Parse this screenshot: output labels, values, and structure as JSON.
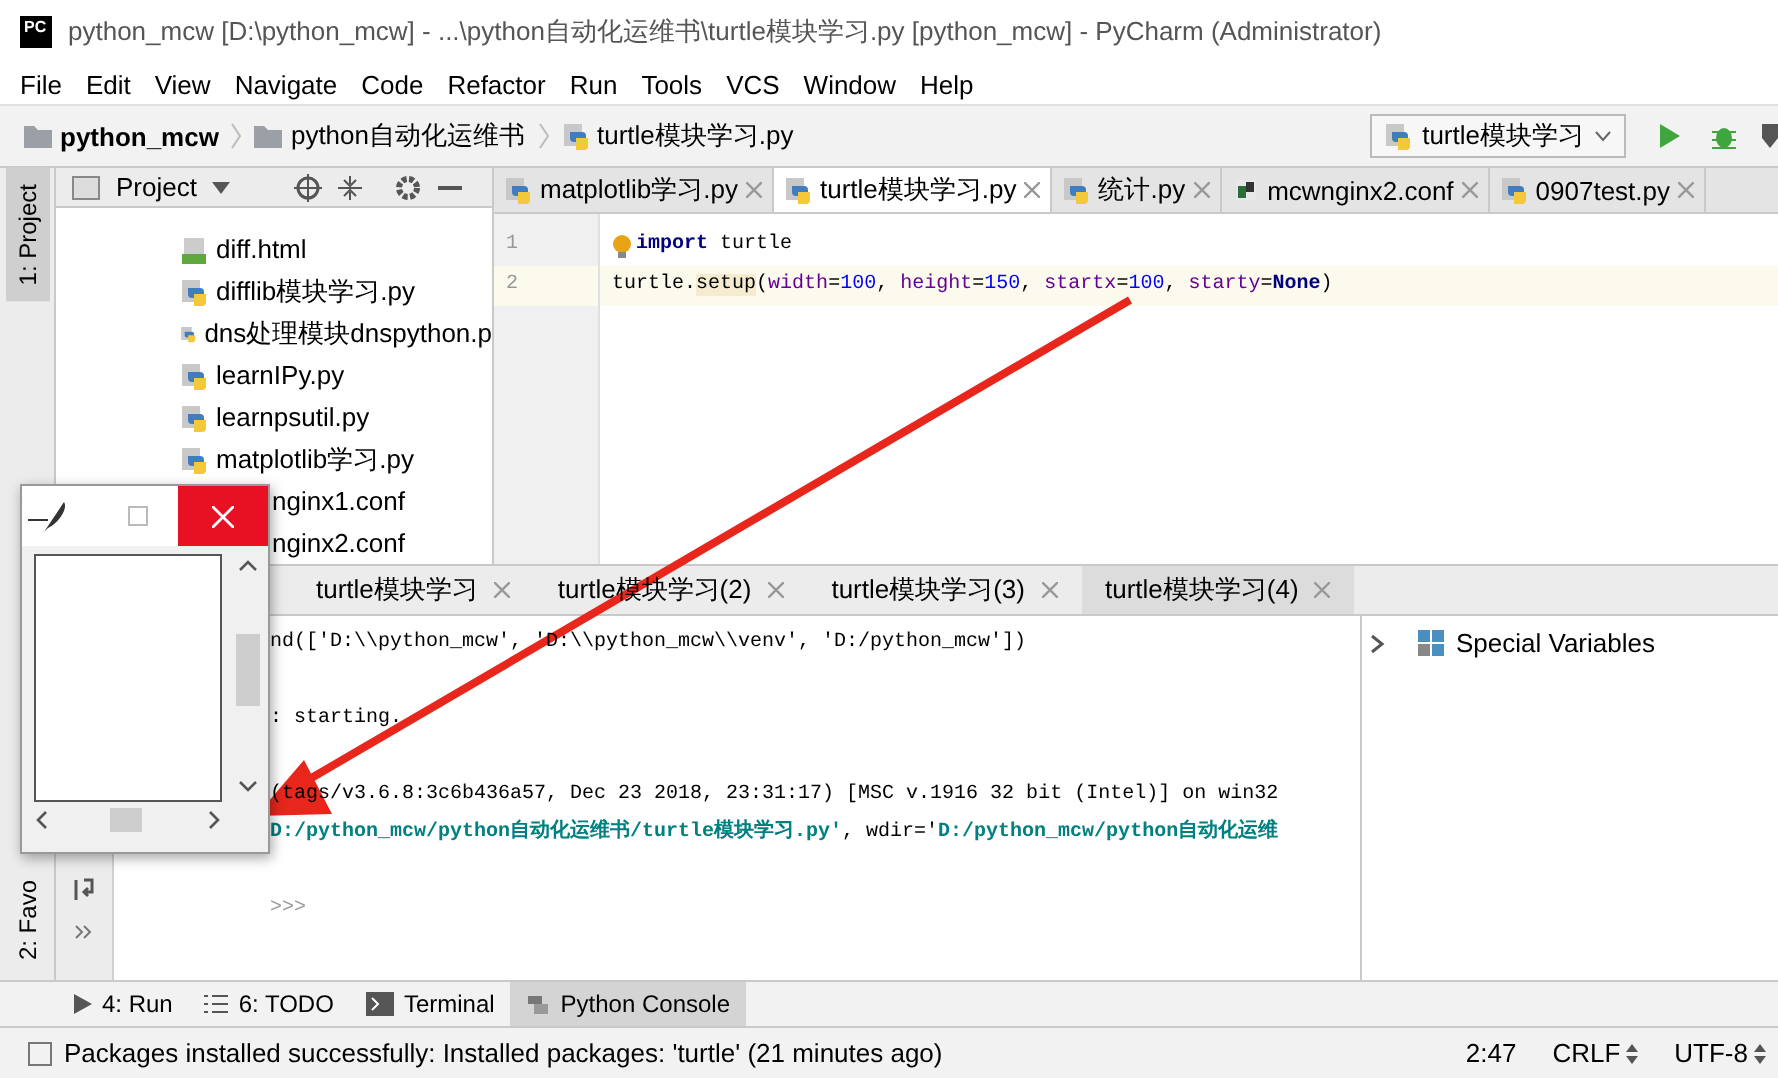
{
  "window": {
    "title": "python_mcw [D:\\python_mcw] - ...\\python自动化运维书\\turtle模块学习.py [python_mcw] - PyCharm (Administrator)",
    "logo": "PC"
  },
  "menu": [
    "File",
    "Edit",
    "View",
    "Navigate",
    "Code",
    "Refactor",
    "Run",
    "Tools",
    "VCS",
    "Window",
    "Help"
  ],
  "breadcrumbs": [
    {
      "label": "python_mcw",
      "kind": "project"
    },
    {
      "label": "python自动化运维书",
      "kind": "folder"
    },
    {
      "label": "turtle模块学习.py",
      "kind": "file"
    }
  ],
  "run_config": {
    "label": "turtle模块学习"
  },
  "left_strip": {
    "top": "1: Project",
    "bottom": "2: Favo"
  },
  "project_panel": {
    "title": "Project",
    "items": [
      {
        "label": "diff.html",
        "kind": "html"
      },
      {
        "label": "difflib模块学习.py",
        "kind": "py"
      },
      {
        "label": "dns处理模块dnspython.p",
        "kind": "py"
      },
      {
        "label": "learnIPy.py",
        "kind": "py"
      },
      {
        "label": "learnpsutil.py",
        "kind": "py"
      },
      {
        "label": "matplotlib学习.py",
        "kind": "py"
      },
      {
        "label": "nginx1.conf"
      },
      {
        "label": "nginx2.conf"
      }
    ]
  },
  "editor_tabs": [
    {
      "label": "matplotlib学习.py",
      "kind": "py",
      "selected": false
    },
    {
      "label": "turtle模块学习.py",
      "kind": "py",
      "selected": true
    },
    {
      "label": "统计.py",
      "kind": "py",
      "selected": false
    },
    {
      "label": "mcwnginx2.conf",
      "kind": "conf",
      "selected": false
    },
    {
      "label": "0907test.py",
      "kind": "py",
      "selected": false
    }
  ],
  "editor": {
    "lines": [
      {
        "number": "1",
        "current": false,
        "tokens": [
          {
            "text": "import",
            "kind": "keyword"
          },
          {
            "text": " turtle",
            "kind": "plain"
          }
        ]
      },
      {
        "number": "2",
        "current": true,
        "tokens": [
          {
            "text": "turtle.",
            "kind": "plain"
          },
          {
            "text": "setup",
            "kind": "call"
          },
          {
            "text": "(",
            "kind": "plain"
          },
          {
            "text": "width",
            "kind": "param"
          },
          {
            "text": "=",
            "kind": "plain"
          },
          {
            "text": "100",
            "kind": "number"
          },
          {
            "text": ", ",
            "kind": "plain"
          },
          {
            "text": "height",
            "kind": "param"
          },
          {
            "text": "=",
            "kind": "plain"
          },
          {
            "text": "150",
            "kind": "number"
          },
          {
            "text": ", ",
            "kind": "plain"
          },
          {
            "text": "startx",
            "kind": "param"
          },
          {
            "text": "=",
            "kind": "plain"
          },
          {
            "text": "100",
            "kind": "number"
          },
          {
            "text": ", ",
            "kind": "plain"
          },
          {
            "text": "starty",
            "kind": "param"
          },
          {
            "text": "=",
            "kind": "plain"
          },
          {
            "text": "None",
            "kind": "constant"
          },
          {
            "text": ")",
            "kind": "plain"
          }
        ]
      }
    ]
  },
  "console_tabs": [
    {
      "label": "turtle模块学习",
      "selected": false
    },
    {
      "label": "turtle模块学习(2)",
      "selected": false
    },
    {
      "label": "turtle模块学习(3)",
      "selected": false
    },
    {
      "label": "turtle模块学习(4)",
      "selected": true
    }
  ],
  "console": {
    "lines": [
      {
        "tokens": [
          {
            "text": "nd(['D:\\\\python_mcw', 'D:\\\\python_mcw\\\\venv', 'D:/python_mcw'])",
            "kind": "plain"
          }
        ]
      },
      {
        "tokens": [
          {
            "text": ": starting.",
            "kind": "plain"
          }
        ]
      },
      {
        "tokens": [
          {
            "text": "(tags/v3.6.8:3c6b436a57, Dec 23 2018, 23:31:17) [MSC v.1916 32 bit (Intel)] on win32",
            "kind": "plain"
          }
        ]
      },
      {
        "tokens": [
          {
            "text": "D:/python_mcw/python自动化运维书/turtle模块学习.py'",
            "kind": "string"
          },
          {
            "text": ", wdir='",
            "kind": "plain"
          },
          {
            "text": "D:/python_mcw/python自动化运维",
            "kind": "string"
          }
        ]
      }
    ],
    "prompt": ">>>"
  },
  "variables": {
    "items": [
      {
        "label": "Special Variables",
        "expanded": false
      }
    ]
  },
  "tool_buttons": [
    {
      "label": "4: Run",
      "kind": "run",
      "selected": false
    },
    {
      "label": "6: TODO",
      "kind": "todo",
      "selected": false
    },
    {
      "label": "Terminal",
      "kind": "terminal",
      "selected": false
    },
    {
      "label": "Python Console",
      "kind": "console",
      "selected": true
    }
  ],
  "status": {
    "message": "Packages installed successfully: Installed packages: 'turtle' (21 minutes ago)",
    "position": "2:47",
    "line_separator": "CRLF",
    "encoding": "UTF-8"
  }
}
